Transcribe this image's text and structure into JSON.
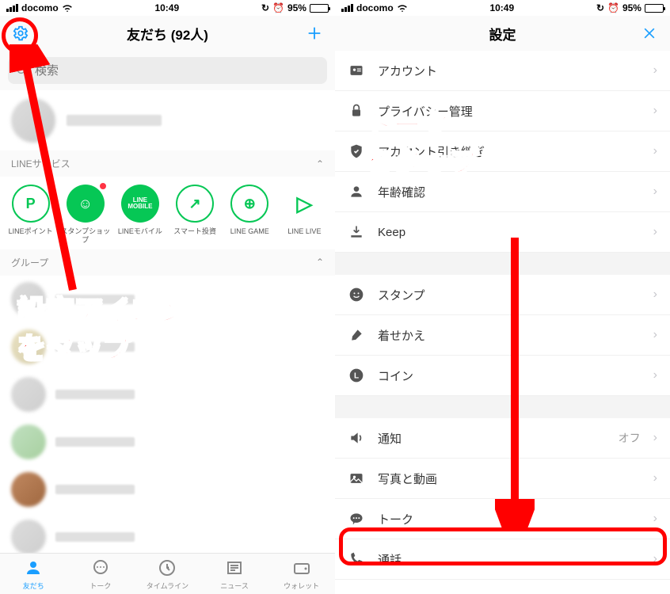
{
  "status": {
    "carrier": "docomo",
    "time": "10:49",
    "battery_pct": "95%",
    "alarm": "⏰"
  },
  "left": {
    "title": "友だち (92人)",
    "search_placeholder": "検索",
    "section_services": "LINEサービス",
    "services": [
      {
        "label": "LINEポイント",
        "glyph": "P",
        "style": "outline"
      },
      {
        "label": "スタンプショップ",
        "glyph": "☺",
        "style": "solid",
        "badge": true
      },
      {
        "label": "LINEモバイル",
        "glyph": "LINE\nMOBILE",
        "style": "solid",
        "small": true
      },
      {
        "label": "スマート投資",
        "glyph": "↗",
        "style": "outline"
      },
      {
        "label": "LINE GAME",
        "glyph": "⊕",
        "style": "outline"
      },
      {
        "label": "LINE LIVE",
        "glyph": "▷",
        "style": "play"
      }
    ],
    "section_groups": "グループ",
    "tabs": [
      {
        "label": "友だち",
        "active": true
      },
      {
        "label": "トーク",
        "badge": ""
      },
      {
        "label": "タイムライン",
        "badge": ""
      },
      {
        "label": "ニュース"
      },
      {
        "label": "ウォレット"
      }
    ]
  },
  "right": {
    "title": "設定",
    "items1": [
      {
        "label": "アカウント",
        "icon": "id"
      },
      {
        "label": "プライバシー管理",
        "icon": "lock"
      },
      {
        "label": "アカウント引き継ぎ",
        "icon": "shield"
      },
      {
        "label": "年齢確認",
        "icon": "person"
      },
      {
        "label": "Keep",
        "icon": "download"
      }
    ],
    "items2": [
      {
        "label": "スタンプ",
        "icon": "smile"
      },
      {
        "label": "着せかえ",
        "icon": "brush"
      },
      {
        "label": "コイン",
        "icon": "coin"
      }
    ],
    "items3": [
      {
        "label": "通知",
        "icon": "speaker",
        "value": "オフ"
      },
      {
        "label": "写真と動画",
        "icon": "photo"
      },
      {
        "label": "トーク",
        "icon": "chat"
      },
      {
        "label": "通話",
        "icon": "phone"
      }
    ]
  },
  "annotations": {
    "left_text": "設定アイコン\nをタップ",
    "right_text": "トーク\nをタップ"
  }
}
